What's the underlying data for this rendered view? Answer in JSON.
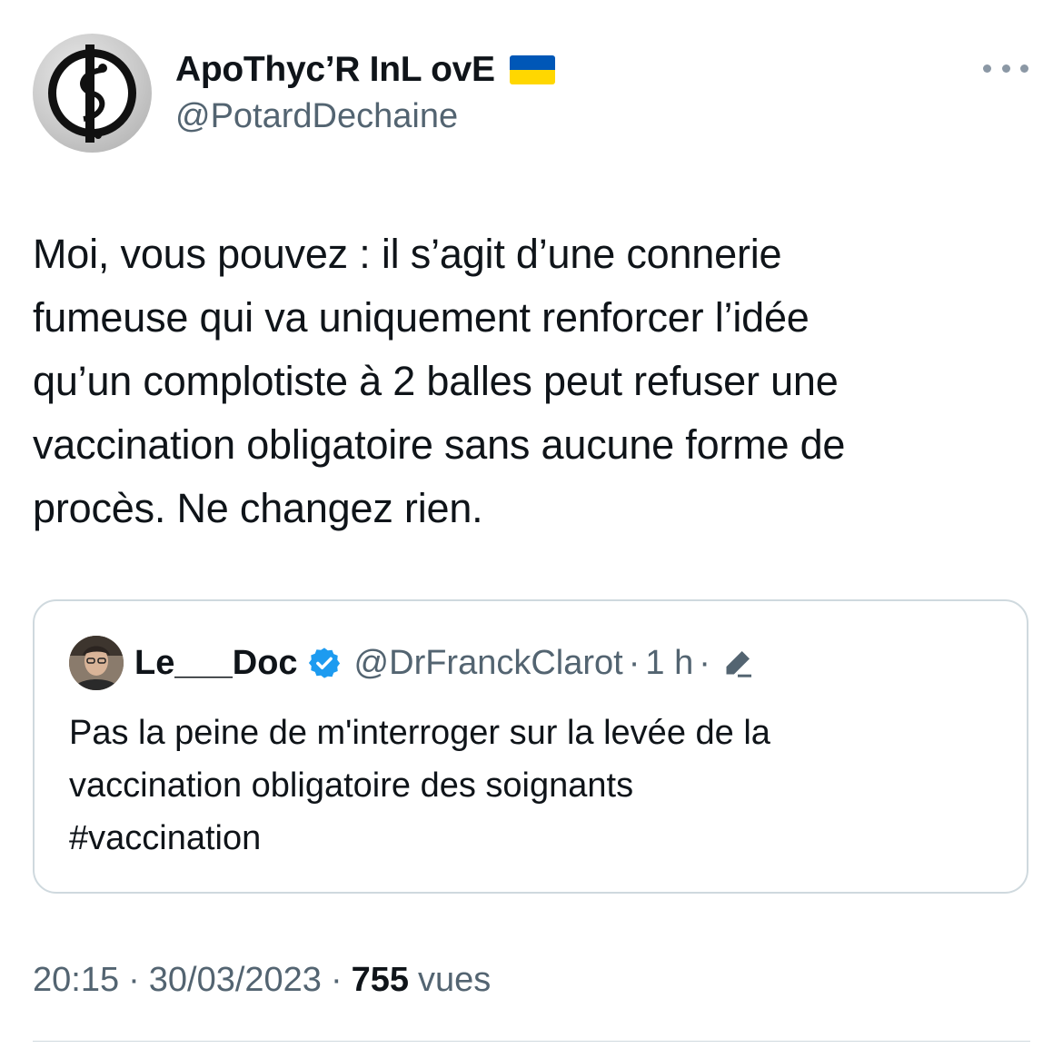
{
  "author": {
    "display_name": "ApoThyc’R InL ovE",
    "handle": "@PotardDechaine",
    "flag_icon": "ukraine-flag-icon",
    "flag_colors": [
      "#0057b7",
      "#ffd700"
    ]
  },
  "tweet": {
    "text": "Moi, vous pouvez : il s’agit d’une connerie\nfumeuse qui va uniquement renforcer l’idée\nqu’un complotiste à 2 balles peut refuser une\nvaccination obligatoire sans aucune forme de\nprocès. Ne changez rien."
  },
  "quote": {
    "display_name": "Le___Doc",
    "verified_icon": "verified-badge-icon",
    "handle": "@DrFranckClarot",
    "separator": "·",
    "time": "1 h",
    "edit_icon": "edit-pencil-icon",
    "text": "Pas la peine de m'interroger sur la levée de la\nvaccination obligatoire des soignants\n#vaccination"
  },
  "meta": {
    "time": "20:15",
    "separator": "·",
    "date": "30/03/2023",
    "views_count": "755",
    "views_label": "vues"
  },
  "colors": {
    "text_primary": "#0f1419",
    "text_secondary": "#536471",
    "border": "#cfd9de",
    "verified_blue": "#1d9bf0"
  }
}
